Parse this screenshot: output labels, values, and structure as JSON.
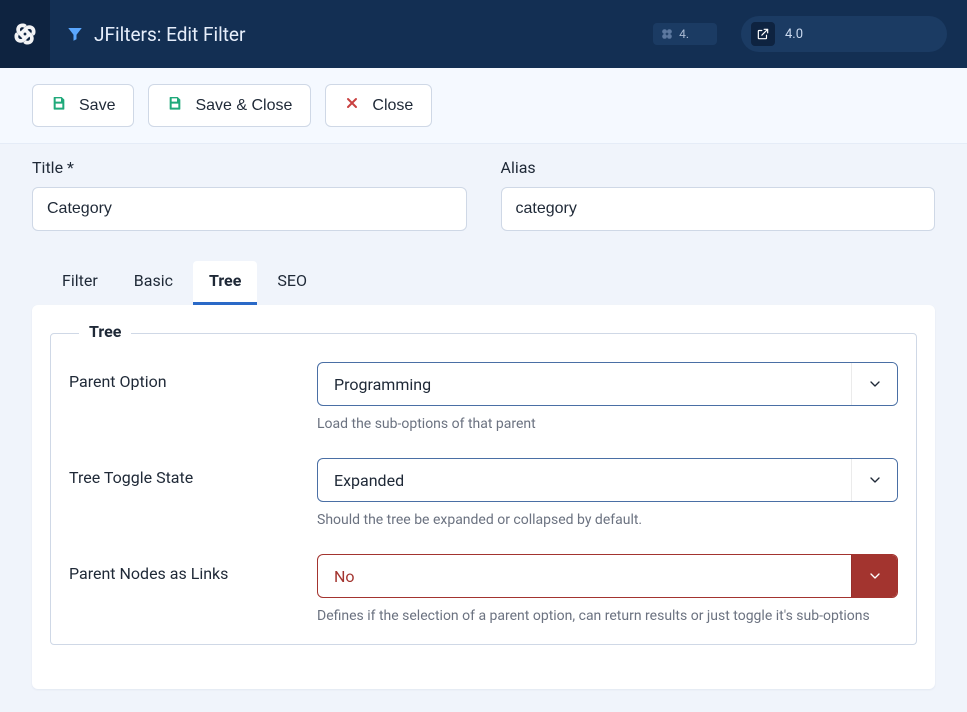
{
  "header": {
    "title": "JFilters: Edit Filter",
    "version_small": "4.",
    "pill_version": "4.0"
  },
  "toolbar": {
    "save": "Save",
    "save_close": "Save & Close",
    "close": "Close"
  },
  "fields": {
    "title_label": "Title *",
    "title_value": "Category",
    "alias_label": "Alias",
    "alias_value": "category"
  },
  "tabs": {
    "filter": "Filter",
    "basic": "Basic",
    "tree": "Tree",
    "seo": "SEO"
  },
  "tree": {
    "legend": "Tree",
    "parent_option": {
      "label": "Parent Option",
      "value": "Programming",
      "help": "Load the sub-options of that parent"
    },
    "toggle_state": {
      "label": "Tree Toggle State",
      "value": "Expanded",
      "help": "Should the tree be expanded or collapsed by default."
    },
    "parent_links": {
      "label": "Parent Nodes as Links",
      "value": "No",
      "help": "Defines if the selection of a parent option, can return results or just toggle it's sub-options"
    }
  }
}
